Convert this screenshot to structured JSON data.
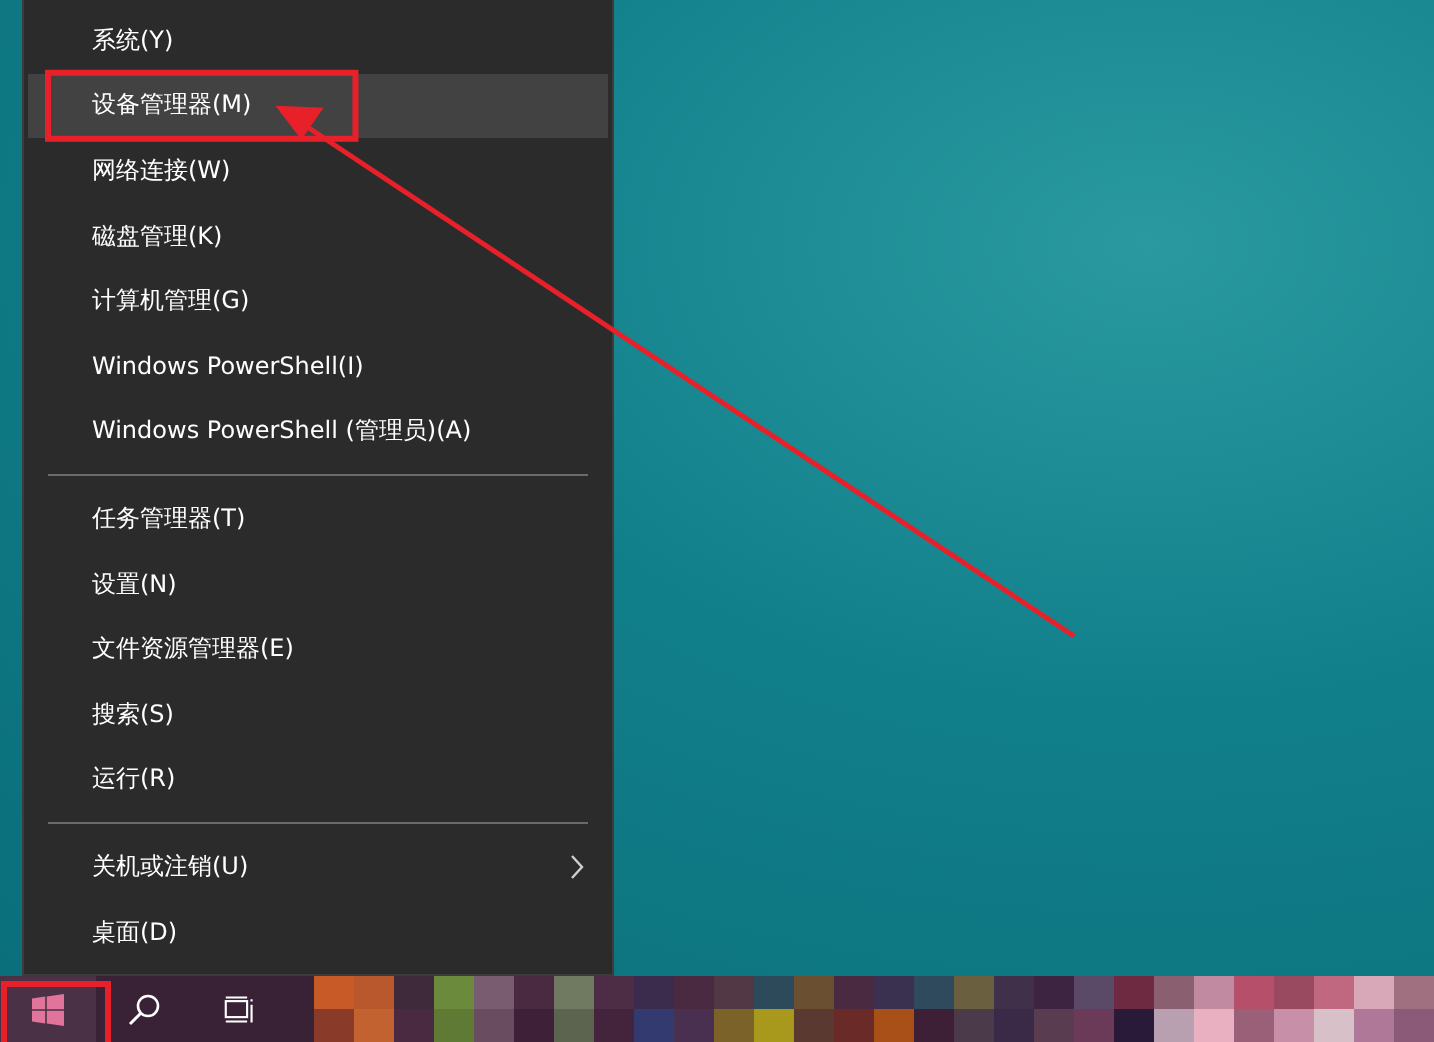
{
  "context_menu": {
    "items": [
      {
        "kind": "item",
        "label": "系统(Y)",
        "selected": false,
        "annotated": false,
        "has_submenu": false
      },
      {
        "kind": "item",
        "label": "设备管理器(M)",
        "selected": true,
        "annotated": true,
        "has_submenu": false
      },
      {
        "kind": "item",
        "label": "网络连接(W)",
        "selected": false,
        "annotated": false,
        "has_submenu": false
      },
      {
        "kind": "item",
        "label": "磁盘管理(K)",
        "selected": false,
        "annotated": false,
        "has_submenu": false
      },
      {
        "kind": "item",
        "label": "计算机管理(G)",
        "selected": false,
        "annotated": false,
        "has_submenu": false
      },
      {
        "kind": "item",
        "label": "Windows PowerShell(I)",
        "selected": false,
        "annotated": false,
        "has_submenu": false
      },
      {
        "kind": "item",
        "label": "Windows PowerShell (管理员)(A)",
        "selected": false,
        "annotated": false,
        "has_submenu": false
      },
      {
        "kind": "separator"
      },
      {
        "kind": "item",
        "label": "任务管理器(T)",
        "selected": false,
        "annotated": false,
        "has_submenu": false
      },
      {
        "kind": "item",
        "label": "设置(N)",
        "selected": false,
        "annotated": false,
        "has_submenu": false
      },
      {
        "kind": "item",
        "label": "文件资源管理器(E)",
        "selected": false,
        "annotated": false,
        "has_submenu": false
      },
      {
        "kind": "item",
        "label": "搜索(S)",
        "selected": false,
        "annotated": false,
        "has_submenu": false
      },
      {
        "kind": "item",
        "label": "运行(R)",
        "selected": false,
        "annotated": false,
        "has_submenu": false
      },
      {
        "kind": "separator"
      },
      {
        "kind": "item",
        "label": "关机或注销(U)",
        "selected": false,
        "annotated": false,
        "has_submenu": true
      },
      {
        "kind": "item",
        "label": "桌面(D)",
        "selected": false,
        "annotated": false,
        "has_submenu": false
      }
    ]
  },
  "taskbar": {
    "buttons": [
      {
        "kind": "start",
        "annotated": true
      },
      {
        "kind": "search",
        "annotated": false
      },
      {
        "kind": "task_view",
        "annotated": false
      }
    ]
  }
}
